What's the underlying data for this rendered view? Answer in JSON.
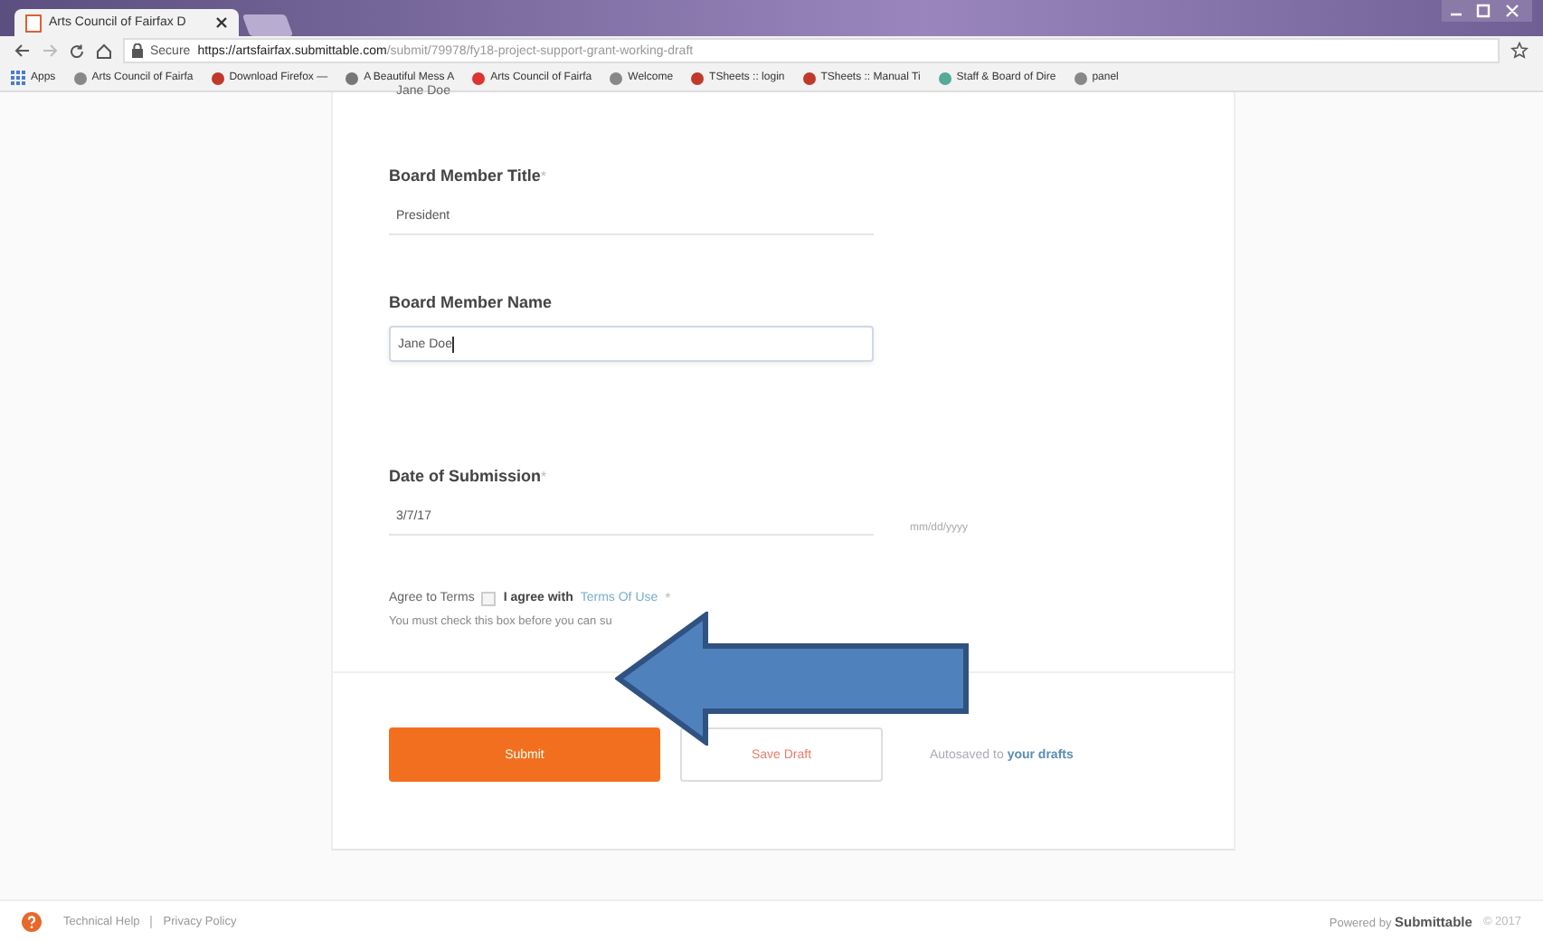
{
  "browser": {
    "tab": {
      "title": "Arts Council of Fairfax D",
      "selected": true
    },
    "address": {
      "secure_label": "Secure",
      "url_host": "https://artsfairfax.submittable.com",
      "url_path": "/submit/79978/fy18-project-support-grant-working-draft"
    },
    "bookmarks": [
      {
        "label": "Apps",
        "kind": "apps"
      },
      {
        "label": "Arts Council of Fairfa",
        "kind": "page"
      },
      {
        "label": "Download Firefox —",
        "kind": "firefox"
      },
      {
        "label": "A Beautiful Mess A",
        "kind": "doc"
      },
      {
        "label": "Arts Council of Fairfa",
        "kind": "mail"
      },
      {
        "label": "Welcome",
        "kind": "page"
      },
      {
        "label": "TSheets :: login",
        "kind": "tsheets"
      },
      {
        "label": "TSheets :: Manual Ti",
        "kind": "tsheets"
      },
      {
        "label": "Staff & Board of Dire",
        "kind": "star"
      },
      {
        "label": "panel",
        "kind": "page"
      }
    ]
  },
  "form": {
    "previous_value": "Jane Doe",
    "fields": [
      {
        "label": "Board Member Title",
        "required_mark": "*",
        "value": "President",
        "kind": "underline",
        "focused": false
      },
      {
        "label": "Board Member Name",
        "value": "Jane Doe",
        "kind": "box",
        "focused": true
      },
      {
        "label": "Date of Submission",
        "required_mark": "*",
        "value": "3/7/17",
        "kind": "date",
        "focused": false,
        "hint": "mm/dd/yyyy"
      }
    ],
    "terms": {
      "label": "Agree to Terms",
      "checked": false,
      "agree_text": "I agree with",
      "link": "Terms Of Use",
      "required_mark": "*",
      "note": "You must check this box before you can su"
    },
    "buttons": [
      {
        "label": "Submit",
        "kind": "primary"
      },
      {
        "label": "Save Draft",
        "kind": "secondary"
      }
    ],
    "autosave": {
      "text": "Autosaved to",
      "link": "your drafts"
    }
  },
  "footer": {
    "links": [
      "Technical Help",
      "Privacy Policy"
    ],
    "powered_by": "Powered by",
    "brand": "Submittable",
    "year": "© 2017"
  }
}
